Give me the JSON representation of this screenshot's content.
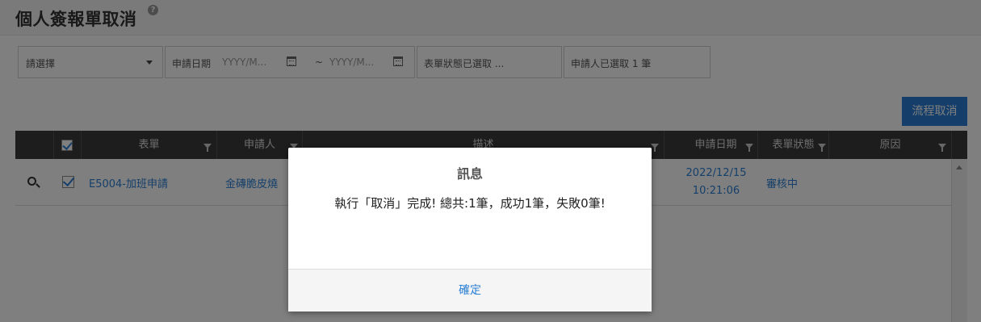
{
  "header": {
    "title": "個人簽報單取消",
    "help_icon": "question-circle-icon",
    "help_glyph": "?"
  },
  "filters": {
    "select_placeholder": "請選擇",
    "date_label": "申請日期",
    "date_from": "YYYY/M...",
    "date_sep": "~",
    "date_to": "YYYY/M...",
    "status": "表單狀態已選取 ...",
    "applicant": "申請人已選取 1 筆"
  },
  "toolbar": {
    "cancel_flow_label": "流程取消"
  },
  "grid": {
    "columns": [
      "表單",
      "申請人",
      "描述",
      "申請日期",
      "表單狀態",
      "原因"
    ],
    "rows": [
      {
        "form": "E5004-加班申請",
        "applicant": "金磚脆皮燒",
        "date": "2022/12/15",
        "time": "10:21:06",
        "status": "審核中",
        "reason": ""
      }
    ]
  },
  "dialog": {
    "title": "訊息",
    "message": "執行「取消」完成! 總共:1筆，成功1筆，失敗0筆!",
    "ok_label": "確定"
  },
  "colors": {
    "accent": "#2a7fd4",
    "header_bg": "#3a3a3a",
    "overlay": "rgba(0,0,0,0.5)"
  }
}
